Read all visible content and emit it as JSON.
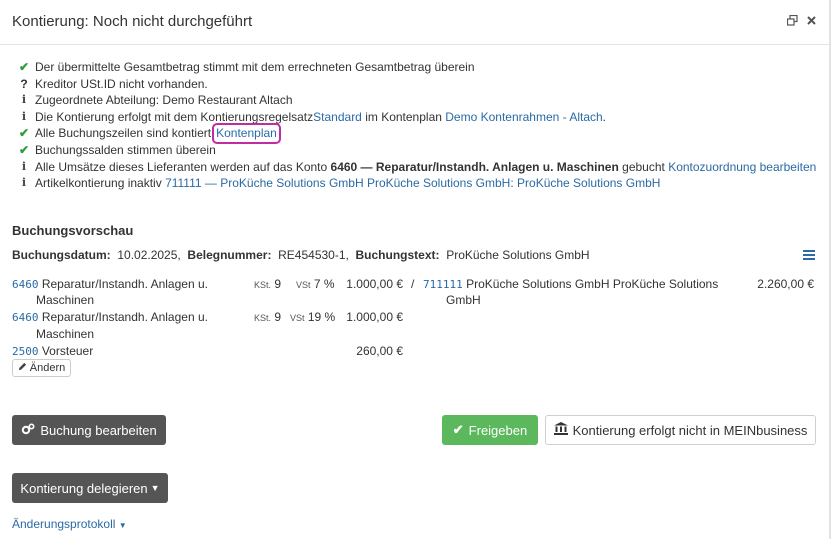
{
  "header": {
    "title": "Kontierung: Noch nicht durchgeführt",
    "icons": [
      "restore-window-icon",
      "close-icon"
    ]
  },
  "checks": [
    {
      "icon": "check-icon",
      "text": "Der übermittelte Gesamtbetrag stimmt mit dem errechneten Gesamtbetrag überein"
    },
    {
      "icon": "question-icon",
      "text": "Kreditor USt.ID nicht vorhanden."
    },
    {
      "icon": "info-icon",
      "text": "Zugeordnete Abteilung: Demo Restaurant Altach"
    },
    {
      "icon": "info-icon",
      "pre": "Die Kontierung erfolgt mit dem Kontierungsregelsatz ",
      "link1": "Standard",
      "mid": " im Kontenplan ",
      "link2": "Demo Kontenrahmen - Altach",
      "post": "."
    },
    {
      "icon": "check-icon",
      "pre": "Alle Buchungszeilen sind kontiert",
      "link": "Kontenplan"
    },
    {
      "icon": "check-icon",
      "text": "Buchungssalden stimmen überein"
    },
    {
      "icon": "info-icon",
      "pre": "Alle Umsätze dieses Lieferanten werden auf das Konto ",
      "bold": "6460 — Reparatur/Instandh. Anlagen u. Maschinen",
      "mid": " gebucht ",
      "link": "Kontozuordnung bearbeiten"
    },
    {
      "icon": "info-icon",
      "pre": "Artikelkontierung inaktiv ",
      "link": "711111 — ProKüche Solutions GmbH ProKüche Solutions GmbH: ProKüche Solutions GmbH"
    }
  ],
  "preview": {
    "title": "Buchungsvorschau",
    "date_label": "Buchungsdatum:",
    "date": "10.02.2025,",
    "doc_label": "Belegnummer:",
    "doc": "RE454530-1,",
    "text_label": "Buchungstext:",
    "text": "ProKüche Solutions GmbH"
  },
  "lines": [
    {
      "acc": "6460",
      "name1": "Reparatur/Instandh. Anlagen u.",
      "name2": "Maschinen",
      "kst_label": "KSt.",
      "kst": "9",
      "vst_label": "VSt",
      "vst": "7 %",
      "amount": "1.000,00 €"
    },
    {
      "acc": "6460",
      "name1": "Reparatur/Instandh. Anlagen u.",
      "name2": "Maschinen",
      "kst_label": "KSt.",
      "kst": "9",
      "vst_label": "VSt",
      "vst": "19 %",
      "amount": "1.000,00 €"
    },
    {
      "acc": "2500",
      "name1": "Vorsteuer",
      "amount": "260,00 €"
    }
  ],
  "credit": {
    "slash": "/",
    "acc": "711111",
    "name1": "ProKüche Solutions GmbH ProKüche Solutions",
    "name2": "GmbH",
    "amount": "2.260,00 €"
  },
  "buttons": {
    "aendern": "Ändern",
    "buchung_bearbeiten": "Buchung bearbeiten",
    "freigeben": "Freigeben",
    "mein_business": "Kontierung erfolgt nicht in MEINbusiness",
    "delegieren": "Kontierung delegieren",
    "protokoll": "Änderungsprotokoll"
  },
  "colors": {
    "accent": "#2a6aa6",
    "green": "#5cb85c",
    "dark_button": "#555555",
    "highlight": "#c32ba0"
  }
}
